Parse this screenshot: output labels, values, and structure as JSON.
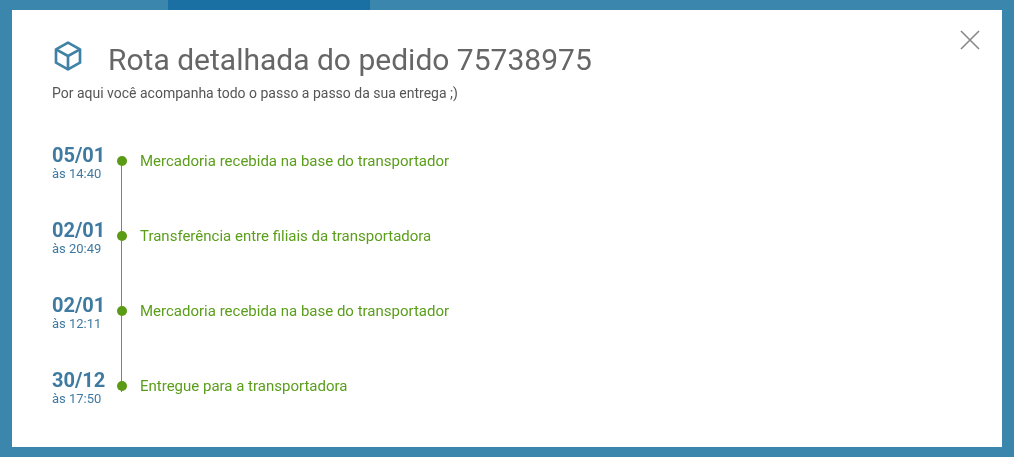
{
  "modal": {
    "title": "Rota detalhada do pedido 75738975",
    "subtitle": "Por aqui você acompanha todo o passo a passo da sua entrega ;)",
    "events": [
      {
        "date": "05/01",
        "time": "às 14:40",
        "description": "Mercadoria recebida na base do transportador"
      },
      {
        "date": "02/01",
        "time": "às 20:49",
        "description": "Transferência entre filiais da transportadora"
      },
      {
        "date": "02/01",
        "time": "às 12:11",
        "description": "Mercadoria recebida na base do transportador"
      },
      {
        "date": "30/12",
        "time": "às 17:50",
        "description": "Entregue para a transportadora"
      }
    ]
  }
}
